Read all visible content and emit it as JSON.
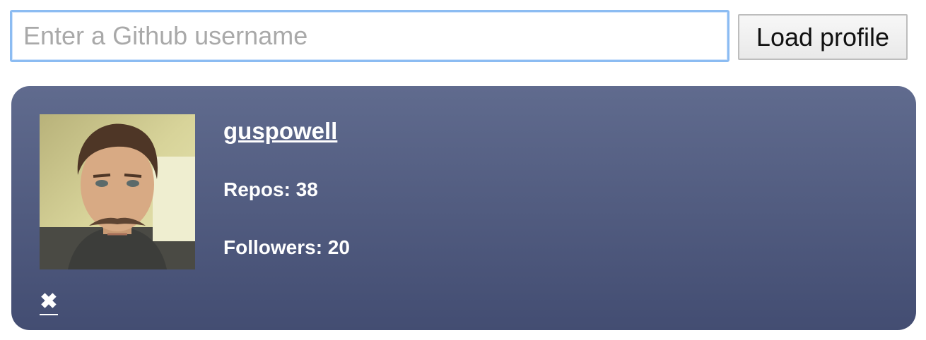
{
  "search": {
    "placeholder": "Enter a Github username",
    "value": ""
  },
  "load_button": {
    "label": "Load profile"
  },
  "profile": {
    "username": "guspowell",
    "repos": "Repos: 38",
    "followers": "Followers: 20",
    "remove_icon": "✖"
  },
  "colors": {
    "card_top": "#606b8e",
    "card_bottom": "#434d72",
    "input_focus": "#8cbcf2"
  }
}
